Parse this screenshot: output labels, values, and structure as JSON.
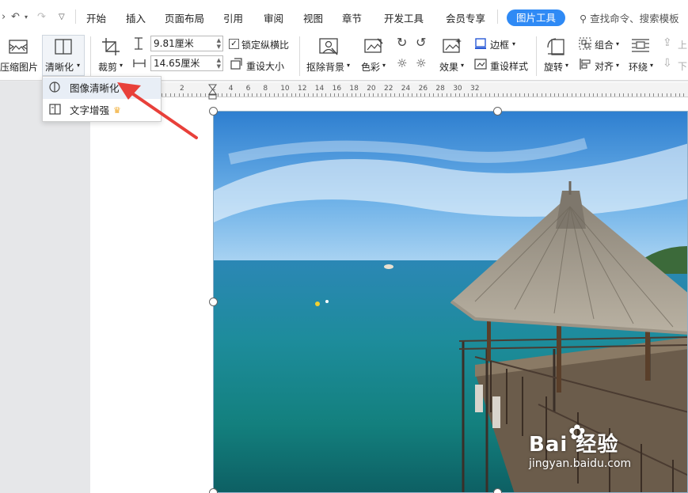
{
  "menubar": {
    "items": [
      "开始",
      "插入",
      "页面布局",
      "引用",
      "审阅",
      "视图",
      "章节",
      "开发工具",
      "会员专享"
    ],
    "active_tab": "图片工具",
    "search_placeholder": "查找命令、搜索模板"
  },
  "ribbon": {
    "compress": "压缩图片",
    "sharpen": "清晰化",
    "crop": "裁剪",
    "width_value": "9.81厘米",
    "height_value": "14.65厘米",
    "lock_ratio": "锁定纵横比",
    "reset_size": "重设大小",
    "remove_bg": "抠除背景",
    "color": "色彩",
    "effects": "效果",
    "border": "边框",
    "reset_style": "重设样式",
    "rotate": "旋转",
    "group": "组合",
    "align": "对齐",
    "wrap": "环绕",
    "up": "上",
    "down": "下"
  },
  "ruler": {
    "labels": [
      "2",
      "2",
      "4",
      "6",
      "8",
      "10",
      "12",
      "14",
      "16",
      "18",
      "20",
      "22",
      "24",
      "26",
      "28",
      "30",
      "32"
    ]
  },
  "dropdown": {
    "items": [
      "图像清晰化",
      "文字增强"
    ]
  },
  "watermark": {
    "brand": "Bai  经验",
    "url": "jingyan.baidu.com"
  },
  "colors": {
    "accent": "#2f8af5",
    "arrow": "#e8403a",
    "crown": "#f0a828"
  }
}
